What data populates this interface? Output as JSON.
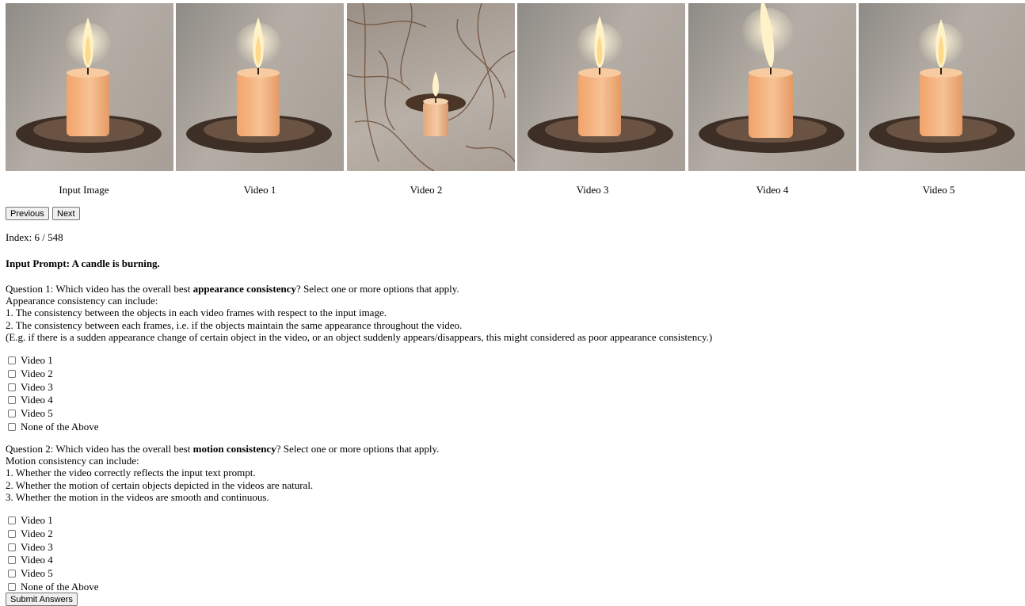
{
  "gallery": {
    "items": [
      {
        "label": "Input Image"
      },
      {
        "label": "Video 1"
      },
      {
        "label": "Video 2"
      },
      {
        "label": "Video 3"
      },
      {
        "label": "Video 4"
      },
      {
        "label": "Video 5"
      }
    ]
  },
  "nav": {
    "previous_label": "Previous",
    "next_label": "Next",
    "index_text": "Index: 6 / 548"
  },
  "prompt": {
    "label": "Input Prompt: A candle is burning."
  },
  "question1": {
    "prefix": "Question 1: Which video has the overall best ",
    "emphasis": "appearance consistency",
    "suffix": "? Select one or more options that apply.",
    "lines": [
      "Appearance consistency can include:",
      "1. The consistency between the objects in each video frames with respect to the input image.",
      "2. The consistency between each frames, i.e. if the objects maintain the same appearance throughout the video.",
      "(E.g. if there is a sudden appearance change of certain object in the video, or an object suddenly appears/disappears, this might considered as poor appearance consistency.)"
    ],
    "options": [
      "Video 1",
      "Video 2",
      "Video 3",
      "Video 4",
      "Video 5",
      "None of the Above"
    ]
  },
  "question2": {
    "prefix": "Question 2: Which video has the overall best ",
    "emphasis": "motion consistency",
    "suffix": "? Select one or more options that apply.",
    "lines": [
      "Motion consistency can include:",
      "1. Whether the video correctly reflects the input text prompt.",
      "2. Whether the motion of certain objects depicted in the videos are natural.",
      "3. Whether the motion in the videos are smooth and continuous."
    ],
    "options": [
      "Video 1",
      "Video 2",
      "Video 3",
      "Video 4",
      "Video 5",
      "None of the Above"
    ]
  },
  "submit": {
    "label": "Submit Answers"
  }
}
